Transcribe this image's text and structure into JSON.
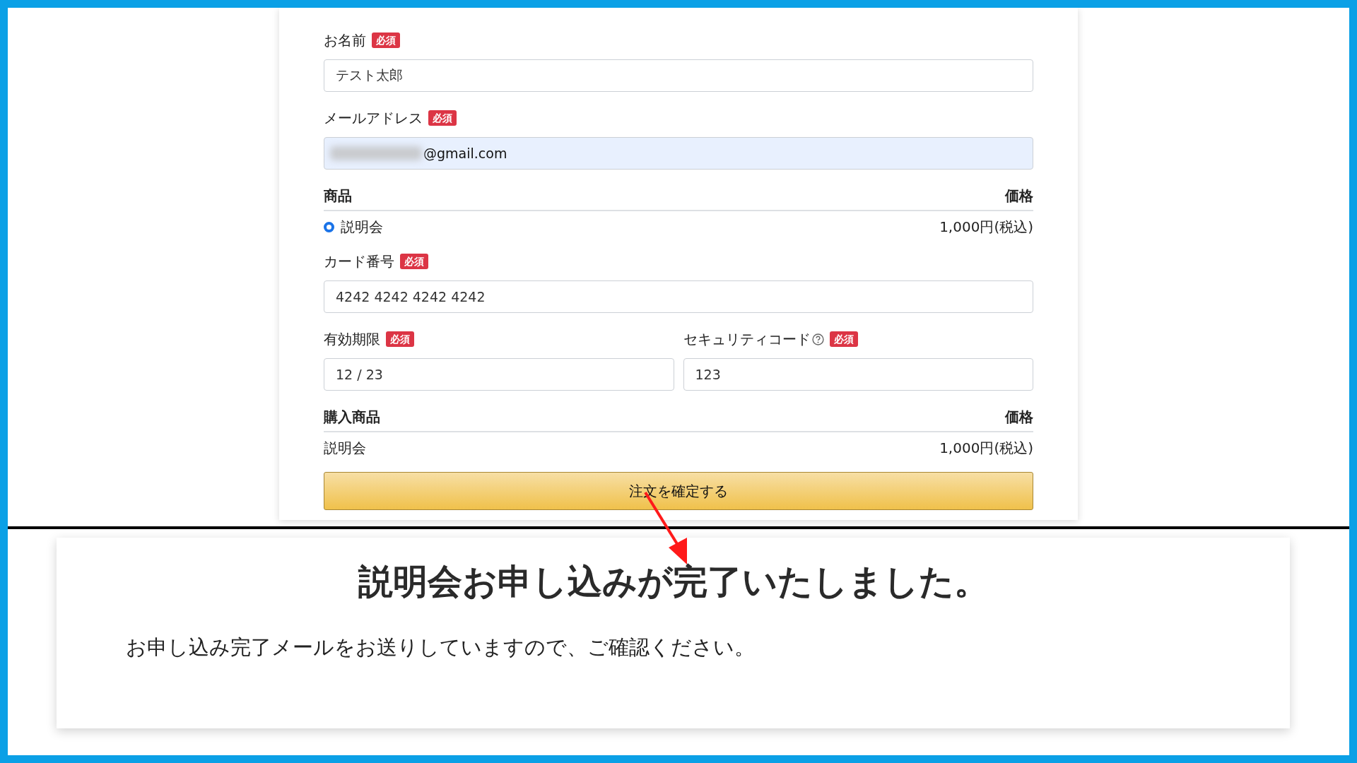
{
  "order_form": {
    "name_field": {
      "label": "お名前",
      "badge": "必須",
      "value": "テスト太郎"
    },
    "email_field": {
      "label": "メールアドレス",
      "badge": "必須",
      "value": "@gmail.com",
      "autofilled": true
    },
    "product_table": {
      "header": {
        "product": "商品",
        "price": "価格"
      },
      "options": [
        {
          "label": "説明会",
          "price": "1,000円(税込)",
          "selected": true
        }
      ]
    },
    "card_number_field": {
      "label": "カード番号",
      "badge": "必須",
      "value": "4242 4242 4242 4242"
    },
    "expiry_field": {
      "label": "有効期限",
      "badge": "必須",
      "value": "12 / 23"
    },
    "security_code_field": {
      "label": "セキュリティコード",
      "badge": "必須",
      "value": "123"
    },
    "summary_table": {
      "header": {
        "product": "購入商品",
        "price": "価格"
      },
      "rows": [
        {
          "item": "説明会",
          "price": "1,000円(税込)"
        }
      ]
    },
    "submit_button": "注文を確定する"
  },
  "completion": {
    "title": "説明会お申し込みが完了いたしました。",
    "message": "お申し込み完了メールをお送りしていますので、ご確認ください。"
  }
}
